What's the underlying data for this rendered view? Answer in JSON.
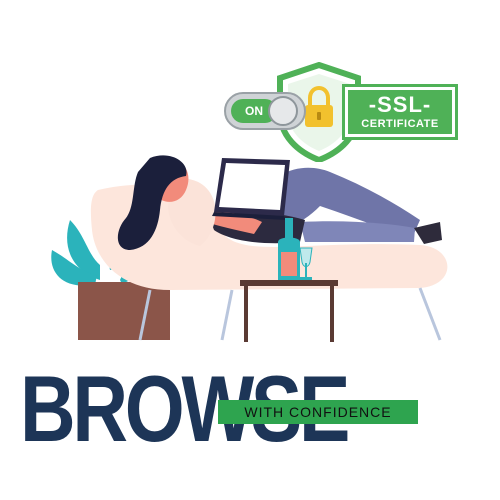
{
  "badge": {
    "toggle_label": "ON",
    "ssl_title": "-SSL-",
    "ssl_subtitle": "CERTIFICATE",
    "accent": "#4fb157",
    "lock_color": "#f2c12e"
  },
  "headline": {
    "title": "BROWSE",
    "tagline": "WITH CONFIDENCE",
    "title_color": "#1d3557",
    "tagline_bg": "#2ea44f"
  },
  "illustration": {
    "subject": "person-reclining-with-laptop-icon",
    "plant": "plant-icon",
    "table": "side-table-icon",
    "bottle": "bottle-icon",
    "glass": "wine-glass-icon"
  }
}
